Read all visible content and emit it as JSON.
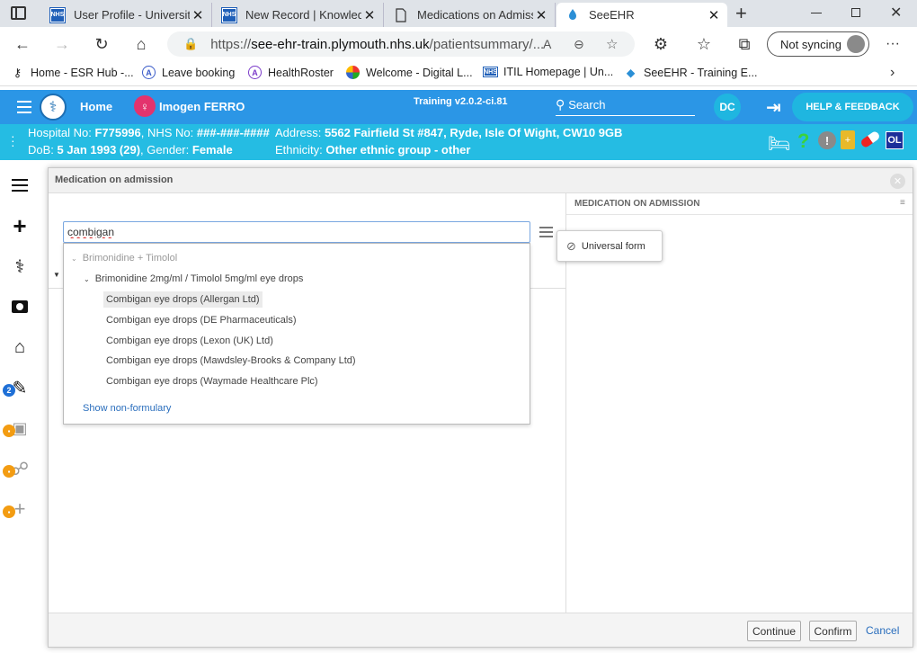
{
  "browser": {
    "tabs": [
      {
        "title": "User Profile - University"
      },
      {
        "title": "New Record | Knowledg"
      },
      {
        "title": "Medications on Admiss"
      },
      {
        "title": "SeeEHR"
      }
    ],
    "url_prefix": "https://",
    "url_main": "see-ehr-train.plymouth.nhs.uk",
    "url_rest": "/patientsummary/...",
    "sync_label": "Not syncing",
    "bookmarks": [
      {
        "label": "Home - ESR Hub -..."
      },
      {
        "label": "Leave booking"
      },
      {
        "label": "HealthRoster"
      },
      {
        "label": "Welcome - Digital L..."
      },
      {
        "label": "ITIL Homepage | Un..."
      },
      {
        "label": "SeeEHR - Training E..."
      }
    ]
  },
  "app": {
    "home_label": "Home",
    "patient_name": "Imogen FERRO",
    "version": "Training v2.0.2-ci.81",
    "search_label": "Search",
    "user_initials": "DC",
    "help_label": "HELP & FEEDBACK"
  },
  "patient": {
    "hospital_label": "Hospital No:",
    "hospital_no": "F775996",
    "nhs_label": ", NHS No:",
    "nhs_no": "###-###-####",
    "dob_label": "DoB:",
    "dob": "5 Jan 1993 (29)",
    "gender_label": ", Gender:",
    "gender": "Female",
    "address_label": "Address:",
    "address": "5562 Fairfield St #847, Ryde, Isle Of Wight, CW10 9GB",
    "ethnicity_label": "Ethnicity:",
    "ethnicity": "Other ethnic group - other",
    "badge_ol": "OL"
  },
  "sidebar": {
    "badge_count": "2"
  },
  "modal": {
    "title": "Medication on admission",
    "right_panel_title": "MEDICATION ON ADMISSION",
    "search_value": "combigan",
    "results": {
      "group": "Brimonidine + Timolol",
      "subgroup": "Brimonidine 2mg/ml / Timolol 5mg/ml eye drops",
      "items": [
        "Combigan eye drops (Allergan Ltd)",
        "Combigan eye drops (DE Pharmaceuticals)",
        "Combigan eye drops (Lexon (UK) Ltd)",
        "Combigan eye drops (Mawdsley-Brooks & Company Ltd)",
        "Combigan eye drops (Waymade Healthcare Plc)"
      ],
      "show_non_formulary": "Show non-formulary"
    },
    "universal_form_label": "Universal form",
    "continue_label": "Continue",
    "confirm_label": "Confirm",
    "cancel_label": "Cancel"
  },
  "colors": {
    "app_header": "#2b96e6",
    "patient_bar": "#25bce3",
    "help_button": "#1fb6e0",
    "link": "#2a6ebd"
  }
}
